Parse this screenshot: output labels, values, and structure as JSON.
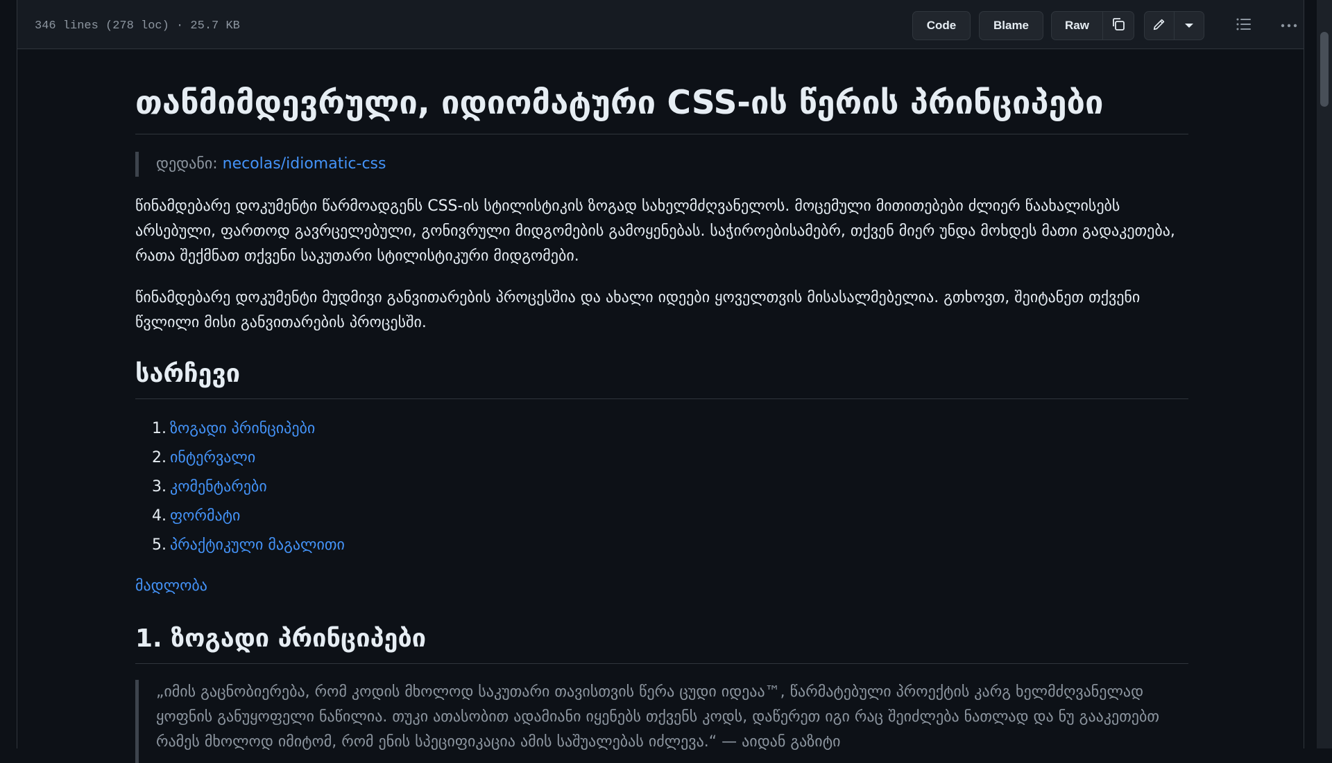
{
  "file_header": {
    "info": "346 lines (278 loc) · 25.7 KB",
    "code_label": "Code",
    "blame_label": "Blame",
    "raw_label": "Raw"
  },
  "document": {
    "title": "თანმიმდევრული, იდიომატური CSS-ის წერის პრინციპები",
    "source_prefix": "დედანი: ",
    "source_link": "necolas/idiomatic-css",
    "intro_1": "წინამდებარე დოკუმენტი წარმოადგენს CSS-ის სტილისტიკის ზოგად სახელმძღვანელოს. მოცემული მითითებები ძლიერ წაახალისებს არსებული, ფართოდ გავრცელებული, გონივრული მიდგომების გამოყენებას. საჭიროებისამებრ, თქვენ მიერ უნდა მოხდეს მათი გადაკეთება, რათა შექმნათ თქვენი საკუთარი სტილისტიკური მიდგომები.",
    "intro_2": "წინამდებარე დოკუმენტი მუდმივი განვითარების პროცესშია და ახალი იდეები ყოველთვის მისასალმებელია. გთხოვთ, შეიტანეთ თქვენი წვლილი მისი განვითარების პროცესში.",
    "toc_heading": "სარჩევი",
    "toc": [
      {
        "num": "1.",
        "label": "ზოგადი პრინციპები"
      },
      {
        "num": "2.",
        "label": "ინტერვალი"
      },
      {
        "num": "3.",
        "label": "კომენტარები"
      },
      {
        "num": "4.",
        "label": "ფორმატი"
      },
      {
        "num": "5.",
        "label": "პრაქტიკული მაგალითი"
      }
    ],
    "thanks_link": "მადლობა",
    "section_1_heading": "1. ზოგადი პრინციპები",
    "quote_text": "„იმის გაცნობიერება, რომ კოდის მხოლოდ საკუთარი თავისთვის წერა ცუდი იდეაა™, წარმატებული პროექტის კარგ ხელმძღვანელად ყოფნის განუყოფელი ნაწილია. თუკი ათასობით ადამიანი იყენებს თქვენს კოდს, დაწერეთ იგი რაც შეიძლება ნათლად და ნუ გააკეთებთ რამეს მხოლოდ იმიტომ, რომ ენის სპეციფიკაცია ამის საშუალებას იძლევა.“ — აიდან გაზიტი"
  },
  "icons": [
    "copy-icon",
    "pencil-icon",
    "triangle-down-icon",
    "list-unordered-icon",
    "kebab-horizontal-icon"
  ]
}
